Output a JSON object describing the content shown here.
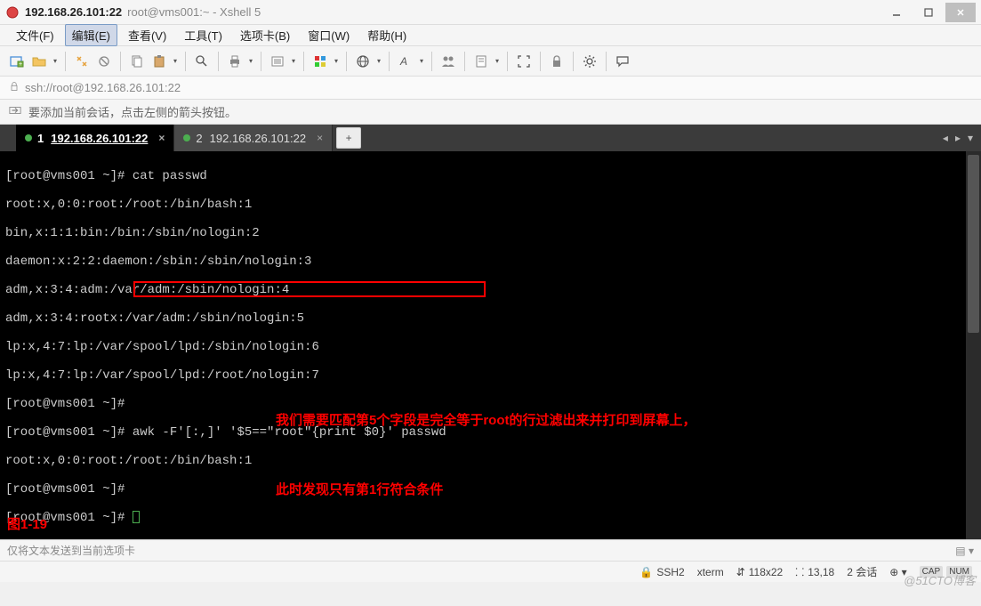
{
  "titlebar": {
    "ip": "192.168.26.101:22",
    "rest": "root@vms001:~ - Xshell 5"
  },
  "menu": {
    "file": "文件(F)",
    "edit": "编辑(E)",
    "view": "查看(V)",
    "tools": "工具(T)",
    "tabs": "选项卡(B)",
    "window": "窗口(W)",
    "help": "帮助(H)"
  },
  "addr": {
    "url": "ssh://root@192.168.26.101:22"
  },
  "info": {
    "text": "要添加当前会话，点击左侧的箭头按钮。"
  },
  "tabs": {
    "t1_num": "1",
    "t1_label": "192.168.26.101:22",
    "t2_num": "2",
    "t2_label": "192.168.26.101:22"
  },
  "term": {
    "l1": "[root@vms001 ~]# cat passwd",
    "l2": "root:x,0:0:root:/root:/bin/bash:1",
    "l3": "bin,x:1:1:bin:/bin:/sbin/nologin:2",
    "l4": "daemon:x:2:2:daemon:/sbin:/sbin/nologin:3",
    "l5": "adm,x:3:4:adm:/var/adm:/sbin/nologin:4",
    "l6": "adm,x:3:4:rootx:/var/adm:/sbin/nologin:5",
    "l7": "lp:x,4:7:lp:/var/spool/lpd:/sbin/nologin:6",
    "l8": "lp:x,4:7:lp:/var/spool/lpd:/root/nologin:7",
    "l9": "[root@vms001 ~]# ",
    "l10": "[root@vms001 ~]# awk -F'[:,]' '$5==\"root\"{print $0}' passwd",
    "l11": "root:x,0:0:root:/root:/bin/bash:1",
    "l12": "[root@vms001 ~]# ",
    "l13": "[root@vms001 ~]# ",
    "anno1": "我们需要匹配第5个字段是完全等于root的行过滤出来并打印到屏幕上，",
    "anno2": "此时发现只有第1行符合条件",
    "fig": "图1-19"
  },
  "sendbar": {
    "text": "仅将文本发送到当前选项卡"
  },
  "status": {
    "ssh": "SSH2",
    "term": "xterm",
    "size": "118x22",
    "pos": "13,18",
    "sessions": "2 会话"
  },
  "watermark": "@51CTO博客"
}
